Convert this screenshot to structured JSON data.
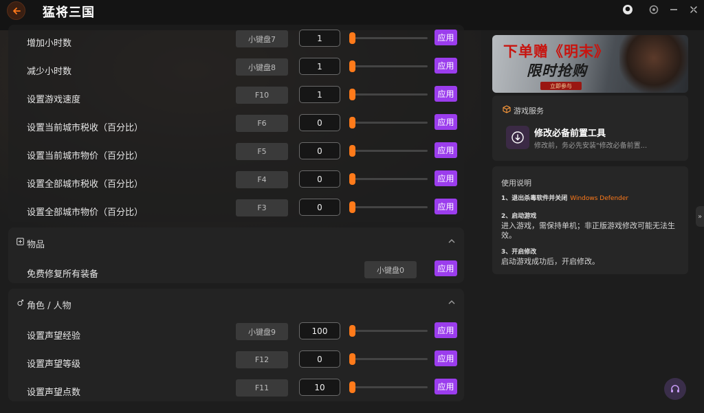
{
  "app": {
    "title": "猛将三国"
  },
  "icons": {
    "back": "back-arrow-icon",
    "account": "user-circle-icon",
    "settings": "gear-icon",
    "minimize": "minimize-icon",
    "close": "close-icon"
  },
  "colors": {
    "accent": "#ff7a1a",
    "apply": "#9b3ded"
  },
  "time_section": {
    "rows": [
      {
        "label": "增加小时数",
        "hotkey": "小键盘7",
        "value": "1",
        "slider": 0,
        "apply": "应用"
      },
      {
        "label": "减少小时数",
        "hotkey": "小键盘8",
        "value": "1",
        "slider": 0,
        "apply": "应用"
      },
      {
        "label": "设置游戏速度",
        "hotkey": "F10",
        "value": "1",
        "slider": 0,
        "apply": "应用"
      },
      {
        "label": "设置当前城市税收（百分比）",
        "hotkey": "F6",
        "value": "0",
        "slider": 0,
        "apply": "应用"
      },
      {
        "label": "设置当前城市物价（百分比）",
        "hotkey": "F5",
        "value": "0",
        "slider": 0,
        "apply": "应用"
      },
      {
        "label": "设置全部城市税收（百分比）",
        "hotkey": "F4",
        "value": "0",
        "slider": 0,
        "apply": "应用"
      },
      {
        "label": "设置全部城市物价（百分比）",
        "hotkey": "F3",
        "value": "0",
        "slider": 0,
        "apply": "应用"
      }
    ]
  },
  "items_section": {
    "title": "物品",
    "rows": [
      {
        "label": "免费修复所有装备",
        "hotkey": "小键盘0",
        "apply": "应用"
      }
    ]
  },
  "character_section": {
    "title": "角色 / 人物",
    "rows": [
      {
        "label": "设置声望经验",
        "hotkey": "小键盘9",
        "value": "100",
        "slider": 0,
        "apply": "应用"
      },
      {
        "label": "设置声望等级",
        "hotkey": "F12",
        "value": "0",
        "slider": 0,
        "apply": "应用"
      },
      {
        "label": "设置声望点数",
        "hotkey": "F11",
        "value": "10",
        "slider": 0,
        "apply": "应用"
      }
    ]
  },
  "banner": {
    "line1": "下单赠《明末》",
    "line2": "限时抢购",
    "cta": "立即参与"
  },
  "service": {
    "title": "游戏服务",
    "tool_name": "修改必备前置工具",
    "tool_desc": "修改前，务必先安装\"修改必备前置..."
  },
  "instructions": {
    "title": "使用说明",
    "step1": "1、退出杀毒软件并关闭",
    "step1_accent": "Windows Defender",
    "step2": "2、启动游戏",
    "step2_body": "进入游戏，需保持单机；非正版游戏修改可能无法生效。",
    "step3": "3、开启修改",
    "step3_body": "启动游戏成功后，开启修改。"
  },
  "side_handle": "»"
}
